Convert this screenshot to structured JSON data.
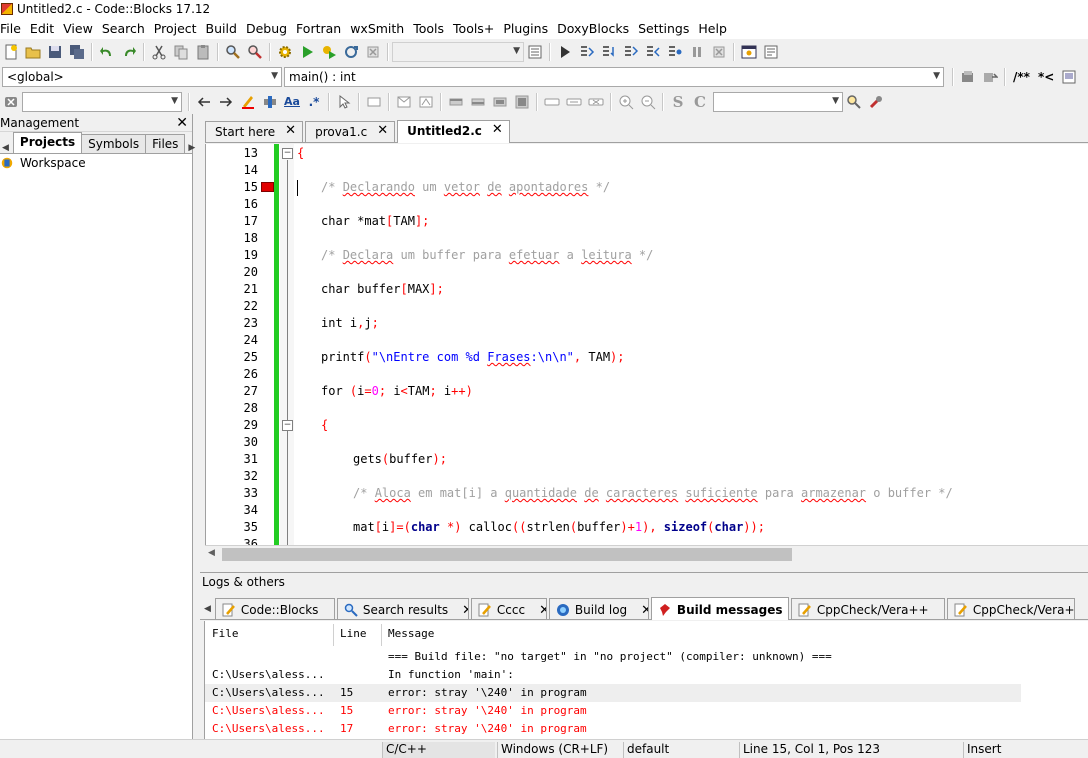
{
  "window": {
    "title": "Untitled2.c - Code::Blocks 17.12"
  },
  "menu": [
    "File",
    "Edit",
    "View",
    "Search",
    "Project",
    "Build",
    "Debug",
    "Fortran",
    "wxSmith",
    "Tools",
    "Tools+",
    "Plugins",
    "DoxyBlocks",
    "Settings",
    "Help"
  ],
  "toolbar2": {
    "scope": "<global>",
    "function": "main() : int",
    "doxy": "/**",
    "doxy2": "*<"
  },
  "search": {
    "value": ""
  },
  "left_panel": {
    "title": "Management",
    "tabs": [
      "Projects",
      "Symbols",
      "Files"
    ],
    "tree_item": "Workspace"
  },
  "editor_tabs": [
    {
      "label": "Start here"
    },
    {
      "label": "prova1.c"
    },
    {
      "label": "Untitled2.c"
    }
  ],
  "code_lines": [
    {
      "n": "13"
    },
    {
      "n": "14"
    },
    {
      "n": "15"
    },
    {
      "n": "16"
    },
    {
      "n": "17"
    },
    {
      "n": "18"
    },
    {
      "n": "19"
    },
    {
      "n": "20"
    },
    {
      "n": "21"
    },
    {
      "n": "22"
    },
    {
      "n": "23"
    },
    {
      "n": "24"
    },
    {
      "n": "25"
    },
    {
      "n": "26"
    },
    {
      "n": "27"
    },
    {
      "n": "28"
    },
    {
      "n": "29"
    },
    {
      "n": "30"
    },
    {
      "n": "31"
    },
    {
      "n": "32"
    },
    {
      "n": "33"
    },
    {
      "n": "34"
    },
    {
      "n": "35"
    },
    {
      "n": "36"
    }
  ],
  "code": {
    "l13": "{",
    "l15a": "/* ",
    "l15b": "Declarando",
    "l15c": " um ",
    "l15d": "vetor",
    "l15e": " ",
    "l15f": "de",
    "l15g": " ",
    "l15h": "apontadores",
    "l15i": " */",
    "l17a": "char",
    "l17b": " *mat",
    "l17c": "[",
    "l17d": "TAM",
    "l17e": "];",
    "l19a": "/* ",
    "l19b": "Declara",
    "l19c": " um buffer para ",
    "l19d": "efetuar",
    "l19e": " a ",
    "l19f": "leitura",
    "l19g": " */",
    "l21a": "char",
    "l21b": " buffer",
    "l21c": "[",
    "l21d": "MAX",
    "l21e": "];",
    "l23a": "int",
    "l23b": " i",
    "l23c": ",",
    "l23d": "j",
    "l23e": ";",
    "l25a": "printf",
    "l25b": "(",
    "l25c": "\"\\nEntre com %d ",
    "l25d": "Frases",
    "l25e": ":\\n\\n\"",
    "l25f": ",",
    "l25g": " TAM",
    "l25h": ");",
    "l27a": "for",
    "l27b": " ",
    "l27c": "(",
    "l27d": "i",
    "l27e": "=",
    "l27f": "0",
    "l27g": ";",
    "l27h": " i",
    "l27i": "<",
    "l27j": "TAM",
    "l27k": ";",
    "l27l": " i",
    "l27m": "++)",
    "l29": "{",
    "l31a": "gets",
    "l31b": "(",
    "l31c": "buffer",
    "l31d": ");",
    "l33a": "/* ",
    "l33b": "Aloca",
    "l33c": " em mat[i] a ",
    "l33d": "quantidade",
    "l33e": " ",
    "l33f": "de",
    "l33g": " ",
    "l33h": "caracteres",
    "l33i": " ",
    "l33j": "suficiente",
    "l33k": " para ",
    "l33l": "armazenar",
    "l33m": " o buffer */",
    "l35a": "mat",
    "l35b": "[",
    "l35c": "i",
    "l35d": "]=(",
    "l35e": "char",
    "l35f": " *)",
    "l35g": " calloc",
    "l35h": "((",
    "l35i": "strlen",
    "l35j": "(",
    "l35k": "buffer",
    "l35l": ")+",
    "l35m": "1",
    "l35n": "),",
    "l35o": " ",
    "l35p": "sizeof",
    "l35q": "(",
    "l35r": "char",
    "l35s": "));"
  },
  "logs": {
    "title": "Logs & others",
    "tabs": [
      {
        "label": "Code::Blocks",
        "icon": "doc-pencil-icon"
      },
      {
        "label": "Search results",
        "icon": "magnifier-icon"
      },
      {
        "label": "Cccc",
        "icon": "doc-pencil-icon"
      },
      {
        "label": "Build log",
        "icon": "gear-globe-icon"
      },
      {
        "label": "Build messages",
        "icon": "red-pin-icon"
      },
      {
        "label": "CppCheck/Vera++",
        "icon": "doc-pencil-icon"
      },
      {
        "label": "CppCheck/Vera++ me",
        "icon": "doc-pencil-icon"
      }
    ],
    "columns": [
      "File",
      "Line",
      "Message"
    ],
    "rows": [
      {
        "file": "",
        "line": "",
        "msg": "=== Build file: \"no target\" in \"no project\" (compiler: unknown) ===",
        "type": "info"
      },
      {
        "file": "C:\\Users\\aless...",
        "line": "",
        "msg": "In function 'main':",
        "type": "info"
      },
      {
        "file": "C:\\Users\\aless...",
        "line": "15",
        "msg": "error: stray '\\240' in program",
        "type": "selected"
      },
      {
        "file": "C:\\Users\\aless...",
        "line": "15",
        "msg": "error: stray '\\240' in program",
        "type": "error"
      },
      {
        "file": "C:\\Users\\aless...",
        "line": "17",
        "msg": "error: stray '\\240' in program",
        "type": "error"
      }
    ]
  },
  "status": {
    "lang": "C/C++",
    "eol": "Windows (CR+LF)",
    "encoding": "default",
    "position": "Line 15, Col 1, Pos 123",
    "mode": "Insert"
  }
}
